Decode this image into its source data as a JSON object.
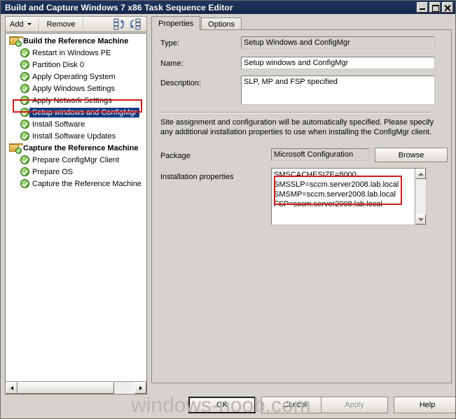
{
  "window": {
    "title": "Build and Capture Windows 7 x86 Task Sequence Editor",
    "minimize_label": "Minimize",
    "maximize_label": "Maximize",
    "close_label": "Close"
  },
  "toolbar": {
    "add_label": "Add",
    "remove_label": "Remove",
    "move_up_label": "Move Up",
    "move_down_label": "Move Down"
  },
  "tree": {
    "items": [
      {
        "label": "Build the Reference Machine",
        "type": "group",
        "selected": false
      },
      {
        "label": "Restart in Windows PE",
        "type": "step",
        "selected": false
      },
      {
        "label": "Partition Disk 0",
        "type": "step",
        "selected": false
      },
      {
        "label": "Apply Operating System",
        "type": "step",
        "selected": false
      },
      {
        "label": "Apply Windows Settings",
        "type": "step",
        "selected": false
      },
      {
        "label": "Apply Network Settings",
        "type": "step",
        "selected": false
      },
      {
        "label": "Setup windows and ConfigMgr",
        "type": "step",
        "selected": true
      },
      {
        "label": "Install Software",
        "type": "step",
        "selected": false
      },
      {
        "label": "Install Software Updates",
        "type": "step",
        "selected": false
      },
      {
        "label": "Capture the Reference Machine",
        "type": "group",
        "selected": false
      },
      {
        "label": "Prepare ConfigMgr Client",
        "type": "step",
        "selected": false
      },
      {
        "label": "Prepare OS",
        "type": "step",
        "selected": false
      },
      {
        "label": "Capture the Reference Machine",
        "type": "step",
        "selected": false
      }
    ]
  },
  "tabs": [
    {
      "label": "Properties",
      "active": true
    },
    {
      "label": "Options",
      "active": false
    }
  ],
  "properties": {
    "type_label": "Type:",
    "type_value": "Setup Windows and ConfigMgr",
    "name_label": "Name:",
    "name_value": "Setup windows and ConfigMgr",
    "description_label": "Description:",
    "description_value": "SLP, MP and FSP specified",
    "help_text": "Site assignment and configuration will be automatically specified. Please specify any additional installation properties to use when installing the ConfigMgr client.",
    "package_label": "Package",
    "package_value": "Microsoft Configuration",
    "browse_label": "Browse",
    "install_props_label": "Installation properties",
    "install_props_value": "SMSCACHESIZE=8000\nSMSSLP=sccm.server2008.lab.local\nSMSMP=sccm.server2008.lab.local\nFSP=sccm.server2008.lab.local"
  },
  "footer": {
    "ok_label": "OK",
    "cancel_label": "Cancel",
    "apply_label": "Apply",
    "apply_enabled": false,
    "help_label": "Help"
  },
  "watermark": {
    "text": "windows-noob.com"
  },
  "colors": {
    "titlebar": "#1b3156",
    "selection": "#103a7d",
    "annotation": "#d31a1a",
    "dialog_bg": "#d6d3ce"
  }
}
